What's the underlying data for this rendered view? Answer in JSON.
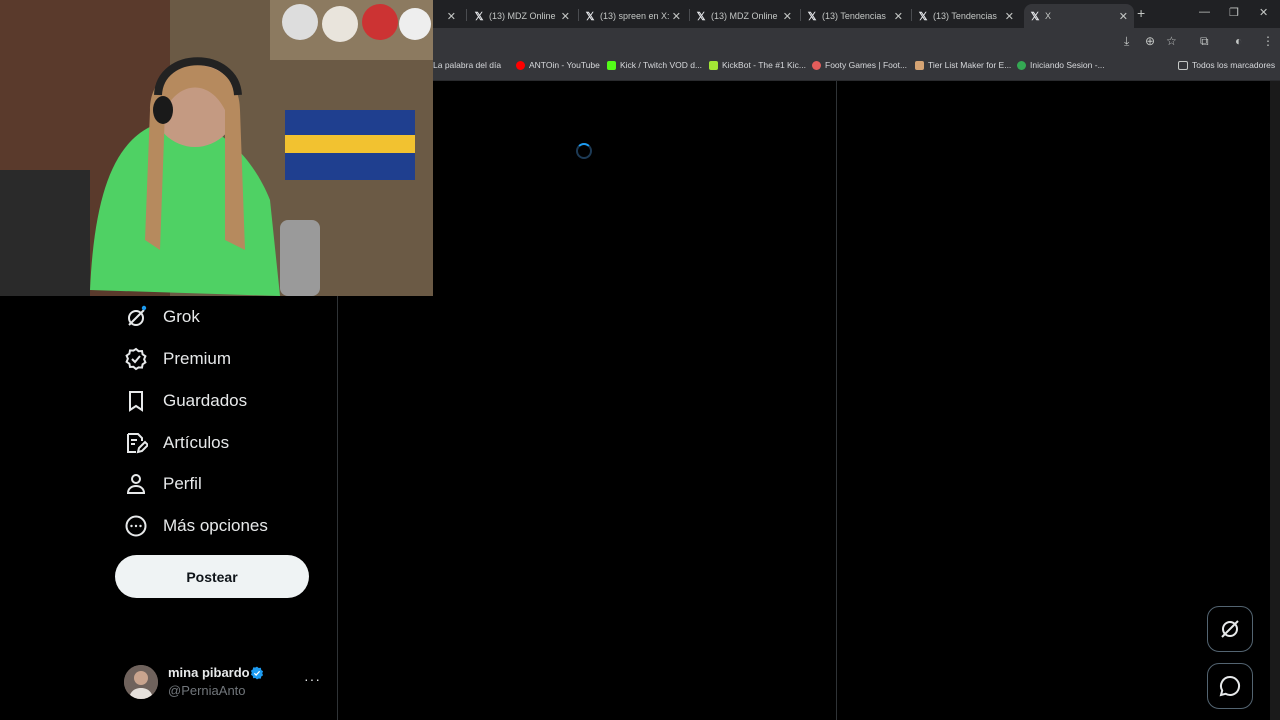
{
  "browser": {
    "tabs": [
      {
        "title": "(13) MDZ Online",
        "close": "✕"
      },
      {
        "title": "(13) spreen en X:",
        "close": "✕"
      },
      {
        "title": "(13) MDZ Online",
        "close": "✕"
      },
      {
        "title": "(13) Tendencias",
        "close": "✕"
      },
      {
        "title": "(13) Tendencias",
        "close": "✕"
      },
      {
        "title": "X",
        "close": "✕"
      }
    ],
    "partial_tab_close": "✕",
    "new_tab": "+",
    "window_controls": {
      "minimize": "—",
      "restore": "❐",
      "close": "✕"
    },
    "bookmarks": [
      {
        "label": "La palabra del día",
        "color": "#8ab4f8"
      },
      {
        "label": "ANTOin - YouTube",
        "color": "#ff0000"
      },
      {
        "label": "Kick / Twitch VOD d...",
        "color": "#53fc18"
      },
      {
        "label": "KickBot - The #1 Kic...",
        "color": "#a3e635"
      },
      {
        "label": "Footy Games | Foot...",
        "color": "#e35d5b"
      },
      {
        "label": "Tier List Maker for E...",
        "color": "#d4a373"
      },
      {
        "label": "Iniciando Sesion -...",
        "color": "#34a853"
      }
    ],
    "all_bookmarks": "Todos los marcadores"
  },
  "nav": {
    "items": [
      {
        "label": "Grok",
        "icon": "grok-icon"
      },
      {
        "label": "Premium",
        "icon": "premium-icon"
      },
      {
        "label": "Guardados",
        "icon": "bookmark-icon"
      },
      {
        "label": "Artículos",
        "icon": "articles-icon"
      },
      {
        "label": "Perfil",
        "icon": "profile-icon"
      },
      {
        "label": "Más opciones",
        "icon": "more-options-icon"
      }
    ],
    "post_label": "Postear"
  },
  "account": {
    "display_name": "mina pibardo",
    "handle": "@PerniaAnto",
    "more": "···"
  },
  "colors": {
    "accent": "#1d9bf0",
    "background": "#000000",
    "post_button_bg": "#eff3f4",
    "divider": "#2f3336"
  }
}
